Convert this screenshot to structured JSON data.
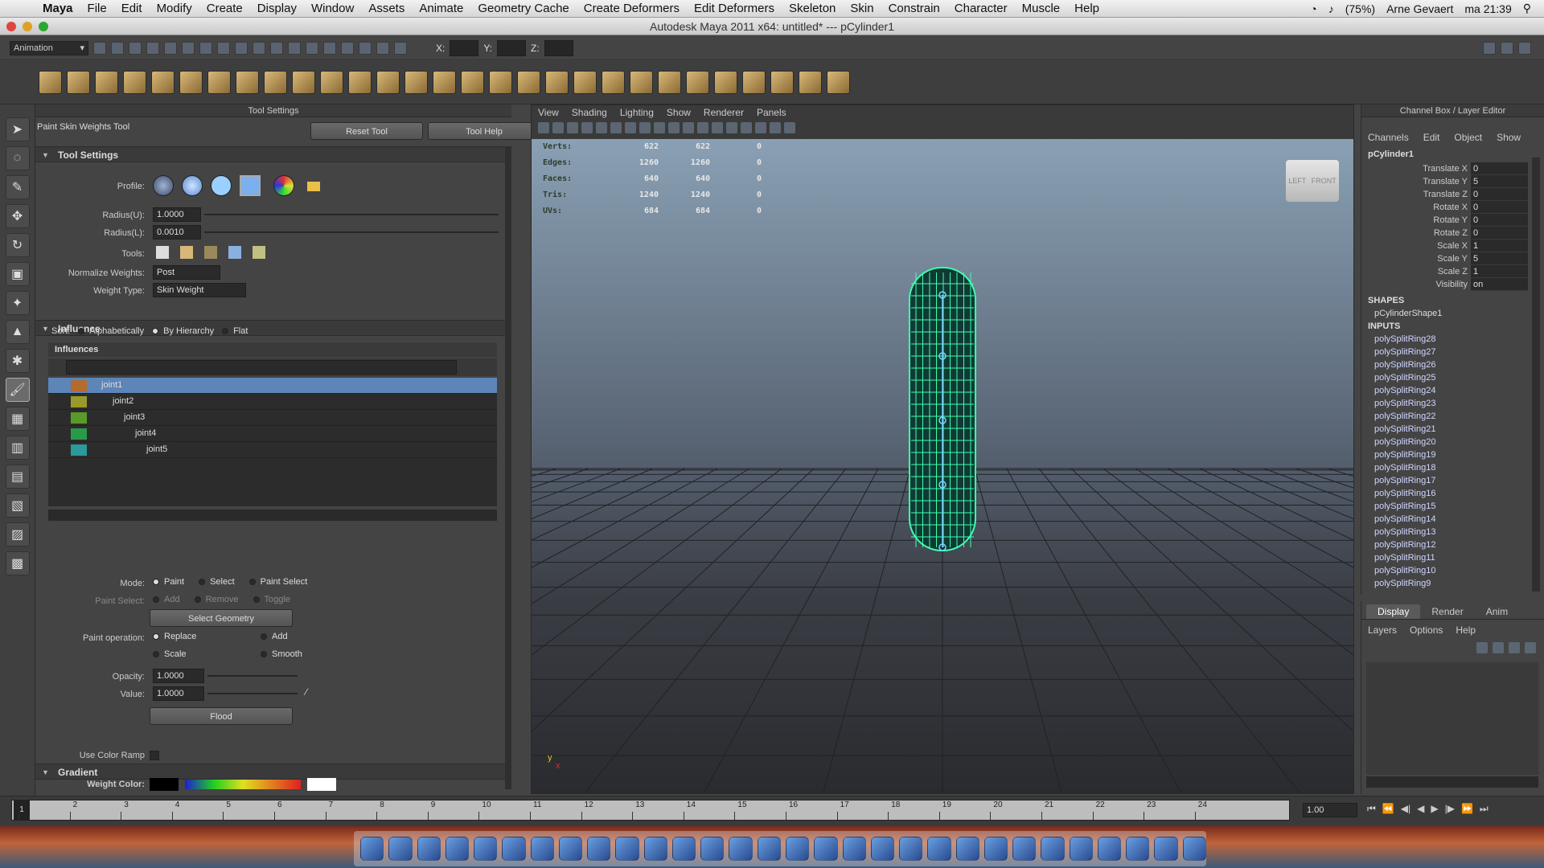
{
  "mac_menu": {
    "app": "Maya",
    "items": [
      "File",
      "Edit",
      "Modify",
      "Create",
      "Display",
      "Window",
      "Assets",
      "Animate",
      "Geometry Cache",
      "Create Deformers",
      "Edit Deformers",
      "Skeleton",
      "Skin",
      "Constrain",
      "Character",
      "Muscle",
      "Help"
    ],
    "battery": "(75%)",
    "user": "Arne Gevaert",
    "clock": "ma 21:39"
  },
  "window_title": "Autodesk Maya 2011 x64: untitled*   ---   pCylinder1",
  "status_line": {
    "mode": "Animation",
    "x_label": "X:",
    "y_label": "Y:",
    "z_label": "Z:"
  },
  "tool_settings": {
    "header": "Tool Settings",
    "tool_name": "Paint Skin Weights Tool",
    "reset_button": "Reset Tool",
    "help_button": "Tool Help",
    "section_title": "Tool Settings",
    "profile_label": "Profile:",
    "radius_u_label": "Radius(U):",
    "radius_u": "1.0000",
    "radius_l_label": "Radius(L):",
    "radius_l": "0.0010",
    "tools_label": "Tools:",
    "normalize_label": "Normalize Weights:",
    "normalize_value": "Post",
    "weight_type_label": "Weight Type:",
    "weight_type_value": "Skin Weight"
  },
  "influence": {
    "section_title": "Influence",
    "sort_label": "Sort:",
    "sort_options": [
      "Alphabetically",
      "By Hierarchy",
      "Flat"
    ],
    "list_header": "Influences",
    "joints": [
      {
        "name": "joint1",
        "color": "#b36b2e",
        "indent": 0,
        "selected": true
      },
      {
        "name": "joint2",
        "color": "#9a9a2a",
        "indent": 1,
        "selected": false
      },
      {
        "name": "joint3",
        "color": "#5a9a2a",
        "indent": 2,
        "selected": false
      },
      {
        "name": "joint4",
        "color": "#2a9a4a",
        "indent": 3,
        "selected": false
      },
      {
        "name": "joint5",
        "color": "#2a9a9a",
        "indent": 4,
        "selected": false
      }
    ]
  },
  "mode": {
    "label": "Mode:",
    "options": [
      "Paint",
      "Select",
      "Paint Select"
    ],
    "paint_select_label": "Paint Select:",
    "paint_select_options": [
      "Add",
      "Remove",
      "Toggle"
    ],
    "select_geometry_button": "Select Geometry",
    "paint_operation_label": "Paint operation:",
    "operations": [
      "Replace",
      "Add",
      "Scale",
      "Smooth"
    ],
    "opacity_label": "Opacity:",
    "opacity": "1.0000",
    "value_label": "Value:",
    "value": "1.0000",
    "flood_button": "Flood"
  },
  "gradient": {
    "section_title": "Gradient",
    "use_color_ramp_label": "Use Color Ramp",
    "weight_color_label": "Weight Color:"
  },
  "viewport": {
    "menu": [
      "View",
      "Shading",
      "Lighting",
      "Show",
      "Renderer",
      "Panels"
    ],
    "hud": [
      {
        "k": "Verts:",
        "a": "622",
        "b": "622",
        "c": "0"
      },
      {
        "k": "Edges:",
        "a": "1260",
        "b": "1260",
        "c": "0"
      },
      {
        "k": "Faces:",
        "a": "640",
        "b": "640",
        "c": "0"
      },
      {
        "k": "Tris:",
        "a": "1240",
        "b": "1240",
        "c": "0"
      },
      {
        "k": "UVs:",
        "a": "684",
        "b": "684",
        "c": "0"
      }
    ],
    "viewcube_left": "LEFT",
    "viewcube_front": "FRONT",
    "axis_y": "y",
    "axis_x": "x"
  },
  "channel_box": {
    "header": "Channel Box / Layer Editor",
    "menu": [
      "Channels",
      "Edit",
      "Object",
      "Show"
    ],
    "object": "pCylinder1",
    "attrs": [
      {
        "k": "Translate X",
        "v": "0"
      },
      {
        "k": "Translate Y",
        "v": "5"
      },
      {
        "k": "Translate Z",
        "v": "0"
      },
      {
        "k": "Rotate X",
        "v": "0"
      },
      {
        "k": "Rotate Y",
        "v": "0"
      },
      {
        "k": "Rotate Z",
        "v": "0"
      },
      {
        "k": "Scale X",
        "v": "1"
      },
      {
        "k": "Scale Y",
        "v": "5"
      },
      {
        "k": "Scale Z",
        "v": "1"
      },
      {
        "k": "Visibility",
        "v": "on"
      }
    ],
    "shapes_label": "SHAPES",
    "shape": "pCylinderShape1",
    "inputs_label": "INPUTS",
    "inputs": [
      "polySplitRing28",
      "polySplitRing27",
      "polySplitRing26",
      "polySplitRing25",
      "polySplitRing24",
      "polySplitRing23",
      "polySplitRing22",
      "polySplitRing21",
      "polySplitRing20",
      "polySplitRing19",
      "polySplitRing18",
      "polySplitRing17",
      "polySplitRing16",
      "polySplitRing15",
      "polySplitRing14",
      "polySplitRing13",
      "polySplitRing12",
      "polySplitRing11",
      "polySplitRing10",
      "polySplitRing9"
    ]
  },
  "layer_editor": {
    "tabs": [
      "Display",
      "Render",
      "Anim"
    ],
    "menu": [
      "Layers",
      "Options",
      "Help"
    ]
  },
  "time_slider": {
    "ticks": [
      "1",
      "2",
      "3",
      "4",
      "5",
      "6",
      "7",
      "8",
      "9",
      "10",
      "11",
      "12",
      "13",
      "14",
      "15",
      "16",
      "17",
      "18",
      "19",
      "20",
      "21",
      "22",
      "23",
      "24"
    ],
    "current_frame": "1",
    "current_time_field": "1.00"
  }
}
